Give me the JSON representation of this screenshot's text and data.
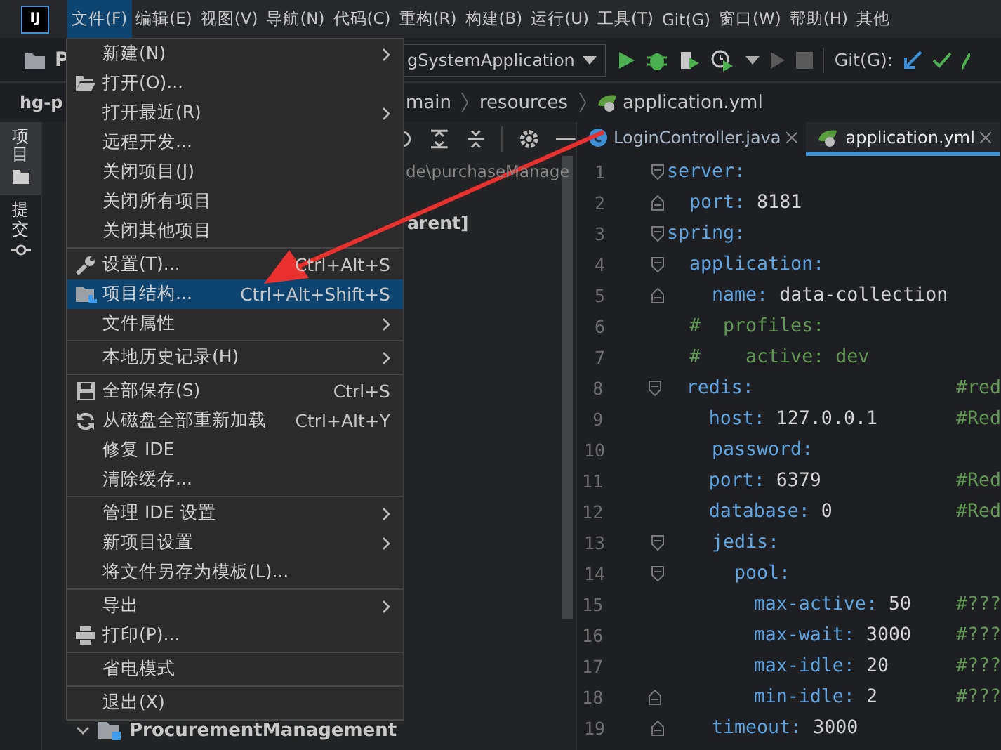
{
  "app": {
    "logo": "IJ"
  },
  "menubar": [
    {
      "label": "文件(F)",
      "selected": true
    },
    {
      "label": "编辑(E)",
      "selected": false
    },
    {
      "label": "视图(V)",
      "selected": false
    },
    {
      "label": "导航(N)",
      "selected": false
    },
    {
      "label": "代码(C)",
      "selected": false
    },
    {
      "label": "重构(R)",
      "selected": false
    },
    {
      "label": "构建(B)",
      "selected": false
    },
    {
      "label": "运行(U)",
      "selected": false
    },
    {
      "label": "工具(T)",
      "selected": false
    },
    {
      "label": "Git(G)",
      "selected": false
    },
    {
      "label": "窗口(W)",
      "selected": false
    },
    {
      "label": "帮助(H)",
      "selected": false
    },
    {
      "label": "其他",
      "selected": false
    }
  ],
  "toolbar": {
    "project_label": "P",
    "run_config": "gSystemApplication",
    "vcs_label": "Git(G):"
  },
  "navbar": {
    "project_title": "hg-p",
    "breadcrumb": [
      {
        "label": "main",
        "kind": "folder"
      },
      {
        "label": "resources",
        "kind": "folder"
      },
      {
        "label": "application.yml",
        "kind": "yaml"
      }
    ]
  },
  "tool_windows": [
    {
      "label": "项目",
      "selected": true
    },
    {
      "label": "提交",
      "selected": false
    }
  ],
  "project_panel": {
    "path": "de\\purchaseManage",
    "header": "arent]",
    "tree": [
      {
        "label": "ProcurementManagement",
        "expanded": true
      }
    ]
  },
  "tabs": [
    {
      "label": "LoginController.java",
      "kind": "java",
      "selected": false
    },
    {
      "label": "application.yml",
      "kind": "yaml",
      "selected": true
    }
  ],
  "code_lines": [
    {
      "n": "1",
      "key": "server:",
      "kind": "fold-start"
    },
    {
      "n": "2",
      "key": "  port:",
      "value": " 8181",
      "kind": "fold-end"
    },
    {
      "n": "3",
      "key": "spring:",
      "kind": "fold-start"
    },
    {
      "n": "4",
      "key": "  application:",
      "kind": "fold-start"
    },
    {
      "n": "5",
      "key": "    name:",
      "value": " data-collection",
      "kind": "fold-end"
    },
    {
      "n": "6",
      "comment": "  #  profiles:"
    },
    {
      "n": "7",
      "comment": "  #    active: dev"
    },
    {
      "n": "8",
      "key": "  redis:",
      "comment": "#red",
      "kind": "fold-start"
    },
    {
      "n": "9",
      "key": "    host:",
      "value": " 127.0.0.1",
      "comment": "#Red"
    },
    {
      "n": "10",
      "key": "    password:"
    },
    {
      "n": "11",
      "key": "    port:",
      "value": " 6379",
      "comment": "#Red"
    },
    {
      "n": "12",
      "key": "    database:",
      "value": " 0",
      "comment": "#Red"
    },
    {
      "n": "13",
      "key": "    jedis:",
      "kind": "fold-start"
    },
    {
      "n": "14",
      "key": "      pool:",
      "kind": "fold-start"
    },
    {
      "n": "15",
      "key": "        max-active:",
      "value": " 50",
      "comment": "#???"
    },
    {
      "n": "16",
      "key": "        max-wait:",
      "value": " 3000",
      "comment": "#???"
    },
    {
      "n": "17",
      "key": "        max-idle:",
      "value": " 20",
      "comment": "#???"
    },
    {
      "n": "18",
      "key": "        min-idle:",
      "value": " 2",
      "comment": "#???",
      "kind": "fold-end"
    },
    {
      "n": "19",
      "key": "    timeout:",
      "value": " 3000",
      "kind": "fold-end"
    }
  ],
  "file_menu": {
    "groups": [
      [
        {
          "label": "新建(N)",
          "submenu": true,
          "selected": false
        },
        {
          "label": "打开(O)...",
          "kind": "folder",
          "submenu": false,
          "selected": false
        },
        {
          "label": "打开最近(R)",
          "submenu": true,
          "selected": false
        },
        {
          "label": "远程开发...",
          "submenu": false,
          "selected": false
        },
        {
          "label": "关闭项目(J)",
          "submenu": false,
          "selected": false
        },
        {
          "label": "关闭所有项目",
          "submenu": false,
          "selected": false
        },
        {
          "label": "关闭其他项目",
          "submenu": false,
          "selected": false
        }
      ],
      [
        {
          "label": "设置(T)...",
          "kind": "wrench",
          "shortcut": "Ctrl+Alt+S",
          "submenu": false,
          "selected": false
        },
        {
          "label": "项目结构...",
          "kind": "structure",
          "shortcut": "Ctrl+Alt+Shift+S",
          "submenu": false,
          "selected": true
        },
        {
          "label": "文件属性",
          "submenu": true,
          "selected": false
        }
      ],
      [
        {
          "label": "本地历史记录(H)",
          "submenu": true,
          "selected": false
        }
      ],
      [
        {
          "label": "全部保存(S)",
          "kind": "save",
          "shortcut": "Ctrl+S",
          "submenu": false,
          "selected": false
        },
        {
          "label": "从磁盘全部重新加载",
          "kind": "reload",
          "shortcut": "Ctrl+Alt+Y",
          "submenu": false,
          "selected": false
        },
        {
          "label": "修复 IDE",
          "submenu": false,
          "selected": false
        },
        {
          "label": "清除缓存...",
          "submenu": false,
          "selected": false
        }
      ],
      [
        {
          "label": "管理 IDE 设置",
          "submenu": true,
          "selected": false
        },
        {
          "label": "新项目设置",
          "submenu": true,
          "selected": false
        },
        {
          "label": "将文件另存为模板(L)...",
          "submenu": false,
          "selected": false
        }
      ],
      [
        {
          "label": "导出",
          "submenu": true,
          "selected": false
        },
        {
          "label": "打印(P)...",
          "kind": "print",
          "submenu": false,
          "selected": false
        }
      ],
      [
        {
          "label": "省电模式",
          "submenu": false,
          "selected": false
        }
      ],
      [
        {
          "label": "退出(X)",
          "submenu": false,
          "selected": false
        }
      ]
    ]
  }
}
